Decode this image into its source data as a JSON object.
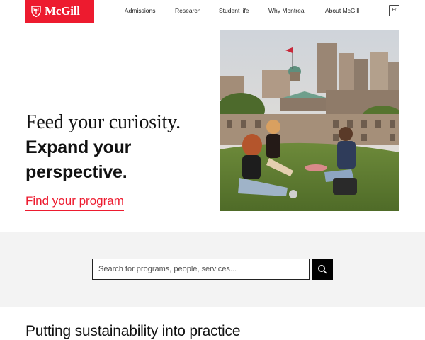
{
  "brand": {
    "name": "McGill",
    "color": "#ed1b2f"
  },
  "nav": {
    "items": [
      "Admissions",
      "Research",
      "Student life",
      "Why Montreal",
      "About McGill"
    ],
    "lang_label": "Fr"
  },
  "hero": {
    "line1": "Feed your curiosity.",
    "line2a": "Expand your",
    "line2b": "perspective.",
    "cta": "Find your program",
    "image_icon": "campus-students-photo"
  },
  "search": {
    "placeholder": "Search for programs, people, services...",
    "button_icon": "search-icon"
  },
  "section": {
    "title": "Putting sustainability into practice"
  }
}
